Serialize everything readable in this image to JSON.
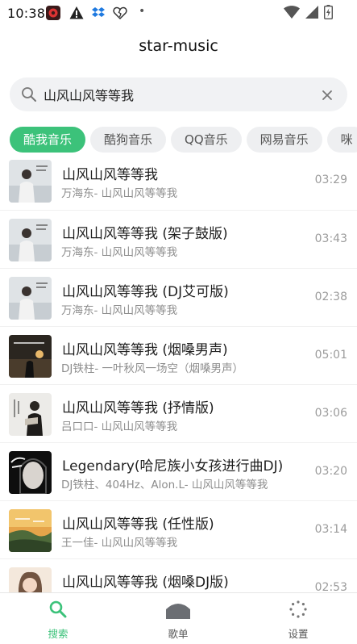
{
  "status_bar": {
    "time": "10:38",
    "dot": "•",
    "icons": [
      "app-notification-icon",
      "warning-icon",
      "dropbox-icon",
      "broken-heart-icon",
      "wifi-icon",
      "signal-icon",
      "battery-icon"
    ]
  },
  "header": {
    "title": "star-music"
  },
  "search": {
    "value": "山风山风等等我",
    "placeholder": "",
    "icon": "search-icon",
    "clear_icon": "close-icon"
  },
  "source_tabs": [
    {
      "label": "酷我音乐",
      "active": true
    },
    {
      "label": "酷狗音乐",
      "active": false
    },
    {
      "label": "QQ音乐",
      "active": false
    },
    {
      "label": "网易音乐",
      "active": false
    },
    {
      "label": "咪",
      "active": false
    }
  ],
  "songs": [
    {
      "title": "山风山风等等我",
      "artist": "万海东- 山风山风等等我",
      "duration": "03:29"
    },
    {
      "title": "山风山风等等我 (架子鼓版)",
      "artist": "万海东- 山风山风等等我",
      "duration": "03:43"
    },
    {
      "title": "山风山风等等我 (DJ艾可版)",
      "artist": "万海东- 山风山风等等我",
      "duration": "02:38"
    },
    {
      "title": "山风山风等等我 (烟嗓男声)",
      "artist": "DJ铁柱- 一叶秋风一场空（烟嗓男声）",
      "duration": "05:01"
    },
    {
      "title": "山风山风等等我 (抒情版)",
      "artist": "吕口口- 山风山风等等我",
      "duration": "03:06"
    },
    {
      "title": "Legendary(哈尼族小女孩进行曲DJ)",
      "artist": "DJ铁柱、404Hz、Alon.L- 山风山风等等我",
      "duration": "03:20"
    },
    {
      "title": "山风山风等等我 (任性版)",
      "artist": "王一佳- 山风山风等等我",
      "duration": "03:14"
    },
    {
      "title": "山风山风等等我 (烟嗓DJ版)",
      "artist": "",
      "duration": "02:53"
    }
  ],
  "bottom_nav": [
    {
      "label": "搜索",
      "icon": "search-icon",
      "active": true
    },
    {
      "label": "歌单",
      "icon": "playlist-icon",
      "active": false
    },
    {
      "label": "设置",
      "icon": "settings-icon",
      "active": false
    }
  ],
  "colors": {
    "accent": "#3cc27a",
    "tab_bg": "#eeeff1",
    "search_bg": "#f1f2f4",
    "secondary_text": "#8d8d8d"
  }
}
